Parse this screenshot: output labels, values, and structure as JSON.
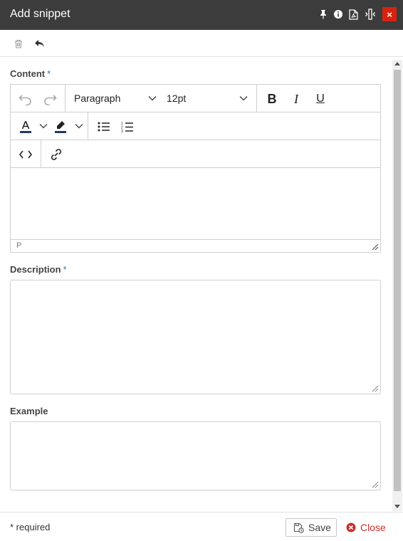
{
  "dialog": {
    "title": "Add snippet",
    "title_icons": [
      "pin-icon",
      "info-icon",
      "pdf-icon",
      "resize-width-icon",
      "close-icon"
    ],
    "close_glyph": "×"
  },
  "actionbar": {
    "icons": [
      "trash-icon",
      "reply-icon"
    ]
  },
  "fields": {
    "content": {
      "label": "Content",
      "required_mark": "*"
    },
    "description": {
      "label": "Description",
      "required_mark": "*"
    },
    "example": {
      "label": "Example"
    }
  },
  "editor": {
    "block_format": "Paragraph",
    "font_size": "12pt",
    "status_path": "P",
    "toolbar_icons": [
      "undo-icon",
      "redo-icon",
      "bold-icon",
      "italic-icon",
      "underline-icon",
      "text-color-icon",
      "highlight-color-icon",
      "bullet-list-icon",
      "numbered-list-icon",
      "source-code-icon",
      "link-icon"
    ],
    "bold_glyph": "B",
    "italic_glyph": "I",
    "underline_glyph": "U",
    "text_color": "#1f3a5f",
    "highlight_color": "#1f3a5f"
  },
  "footer": {
    "required_note": "* required",
    "save_label": "Save",
    "close_label": "Close"
  },
  "colors": {
    "titlebar_bg": "#3c3c3c",
    "close_red": "#d9220d",
    "required_blue": "#2a7ab8",
    "close_text_red": "#c9302c"
  }
}
